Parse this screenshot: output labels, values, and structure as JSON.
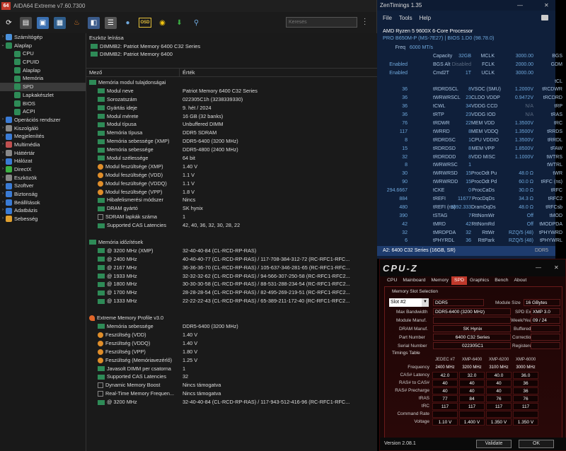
{
  "aida": {
    "title": "AIDA64 Extreme v7.60.7300",
    "logo": "64",
    "search_placeholder": "Keresés",
    "osd": "OSD",
    "tree": [
      {
        "label": "Számítógép",
        "depth": 0,
        "arrow": "›",
        "color": "#4a90d9"
      },
      {
        "label": "Alaplap",
        "depth": 0,
        "arrow": "⌄",
        "color": "#2e8b57"
      },
      {
        "label": "CPU",
        "depth": 1,
        "arrow": "",
        "color": "#2e8b57"
      },
      {
        "label": "CPUID",
        "depth": 1,
        "arrow": "",
        "color": "#2e8b57"
      },
      {
        "label": "Alaplap",
        "depth": 1,
        "arrow": "",
        "color": "#2e8b57"
      },
      {
        "label": "Memória",
        "depth": 1,
        "arrow": "",
        "color": "#2e8b57"
      },
      {
        "label": "SPD",
        "depth": 1,
        "arrow": "",
        "color": "#2e8b57",
        "selected": true
      },
      {
        "label": "Lapkakészlet",
        "depth": 1,
        "arrow": "",
        "color": "#2e8b57"
      },
      {
        "label": "BIOS",
        "depth": 1,
        "arrow": "",
        "color": "#2e8b57"
      },
      {
        "label": "ACPI",
        "depth": 1,
        "arrow": "",
        "color": "#2e8b57"
      },
      {
        "label": "Operációs rendszer",
        "depth": 0,
        "arrow": "›",
        "color": "#3a7bd5"
      },
      {
        "label": "Kiszolgáló",
        "depth": 0,
        "arrow": "›",
        "color": "#888888"
      },
      {
        "label": "Megjelenítés",
        "depth": 0,
        "arrow": "›",
        "color": "#3a7bd5"
      },
      {
        "label": "Multimédia",
        "depth": 0,
        "arrow": "›",
        "color": "#c05050"
      },
      {
        "label": "Háttértár",
        "depth": 0,
        "arrow": "›",
        "color": "#888888"
      },
      {
        "label": "Hálózat",
        "depth": 0,
        "arrow": "›",
        "color": "#3a7bd5"
      },
      {
        "label": "DirectX",
        "depth": 0,
        "arrow": "›",
        "color": "#3cb043"
      },
      {
        "label": "Eszközök",
        "depth": 0,
        "arrow": "›",
        "color": "#888888"
      },
      {
        "label": "Szoftver",
        "depth": 0,
        "arrow": "›",
        "color": "#3a7bd5"
      },
      {
        "label": "Biztonság",
        "depth": 0,
        "arrow": "›",
        "color": "#3a7bd5"
      },
      {
        "label": "Beállítások",
        "depth": 0,
        "arrow": "›",
        "color": "#3a7bd5"
      },
      {
        "label": "Adatbázis",
        "depth": 0,
        "arrow": "›",
        "color": "#3a7bd5"
      },
      {
        "label": "Sebesség",
        "depth": 0,
        "arrow": "›",
        "color": "#e0a030"
      }
    ],
    "device_header": "Eszköz leírása",
    "devices": [
      "DIMMB2: Patriot Memory 6400 C32 Series",
      "DIMMB2: Patriot Memory 6400"
    ],
    "col_field": "Mező",
    "col_value": "Érték",
    "rows": [
      {
        "type": "grp",
        "icon": "chip",
        "f": "Memória modul tulajdonságai",
        "v": ""
      },
      {
        "type": "sub",
        "icon": "chip",
        "f": "Modul neve",
        "v": "Patriot Memory 6400 C32 Series"
      },
      {
        "type": "sub",
        "icon": "chip",
        "f": "Sorozatszám",
        "v": "022305C1h (3238339330)"
      },
      {
        "type": "sub",
        "icon": "chip",
        "f": "Gyártás ideje",
        "v": "9. hét / 2024"
      },
      {
        "type": "sub",
        "icon": "chip",
        "f": "Modul mérete",
        "v": "16 GB (32 banks)"
      },
      {
        "type": "sub",
        "icon": "chip",
        "f": "Modul típusa",
        "v": "Unbuffered DIMM"
      },
      {
        "type": "sub",
        "icon": "chip",
        "f": "Memória típusa",
        "v": "DDR5 SDRAM"
      },
      {
        "type": "sub",
        "icon": "chip",
        "f": "Memória sebessége (XMP)",
        "v": "DDR5-6400 (3200 MHz)"
      },
      {
        "type": "sub",
        "icon": "chip",
        "f": "Memória sebessége",
        "v": "DDR5-4800 (2400 MHz)"
      },
      {
        "type": "sub",
        "icon": "chip",
        "f": "Modul szélessége",
        "v": "64 bit"
      },
      {
        "type": "sub",
        "icon": "warn",
        "f": "Modul feszültsége (XMP)",
        "v": "1.40 V"
      },
      {
        "type": "sub",
        "icon": "warn",
        "f": "Modul feszültsége (VDD)",
        "v": "1.1 V"
      },
      {
        "type": "sub",
        "icon": "warn",
        "f": "Modul feszültsége (VDDQ)",
        "v": "1.1 V"
      },
      {
        "type": "sub",
        "icon": "warn",
        "f": "Modul feszültsége (VPP)",
        "v": "1.8 V"
      },
      {
        "type": "sub",
        "icon": "chip",
        "f": "Hibafelismerési módszer",
        "v": "Nincs"
      },
      {
        "type": "sub",
        "icon": "chip",
        "f": "DRAM gyártó",
        "v": "SK hynix"
      },
      {
        "type": "sub",
        "icon": "chk",
        "f": "SDRAM lapkák száma",
        "v": "1"
      },
      {
        "type": "sub",
        "icon": "chip",
        "f": "Supported CAS Latencies",
        "v": "42, 40, 36, 32, 30, 28, 22"
      },
      {
        "type": "gap"
      },
      {
        "type": "grp",
        "icon": "chip",
        "f": "Memória időzítések",
        "v": ""
      },
      {
        "type": "sub",
        "icon": "chip",
        "f": "@ 3200 MHz (XMP)",
        "v": "32-40-40-84  (CL-RCD-RP-RAS)"
      },
      {
        "type": "sub",
        "icon": "chip",
        "f": "@ 2400 MHz",
        "v": "40-40-40-77  (CL-RCD-RP-RAS) / 117-708-384-312-72  (RC-RFC1-RFC..."
      },
      {
        "type": "sub",
        "icon": "chip",
        "f": "@ 2167 MHz",
        "v": "36-36-36-70  (CL-RCD-RP-RAS) / 105-637-346-281-65  (RC-RFC1-RFC..."
      },
      {
        "type": "sub",
        "icon": "chip",
        "f": "@ 1933 MHz",
        "v": "32-32-32-62  (CL-RCD-RP-RAS) / 94-566-307-250-58  (RC-RFC1-RFC2..."
      },
      {
        "type": "sub",
        "icon": "chip",
        "f": "@ 1800 MHz",
        "v": "30-30-30-58  (CL-RCD-RP-RAS) / 88-531-288-234-54  (RC-RFC1-RFC2..."
      },
      {
        "type": "sub",
        "icon": "chip",
        "f": "@ 1700 MHz",
        "v": "28-28-28-54  (CL-RCD-RP-RAS) / 82-495-269-219-51  (RC-RFC1-RFC2..."
      },
      {
        "type": "sub",
        "icon": "chip",
        "f": "@ 1333 MHz",
        "v": "22-22-22-43  (CL-RCD-RP-RAS) / 65-389-211-172-40  (RC-RFC1-RFC2..."
      },
      {
        "type": "gap"
      },
      {
        "type": "grp",
        "icon": "fire",
        "f": "Extreme Memory Profile v3.0",
        "v": ""
      },
      {
        "type": "sub",
        "icon": "chip",
        "f": "Memória sebessége",
        "v": "DDR5-6400 (3200 MHz)"
      },
      {
        "type": "sub",
        "icon": "warn",
        "f": "Feszültség (VDD)",
        "v": "1.40 V"
      },
      {
        "type": "sub",
        "icon": "warn",
        "f": "Feszültség (VDDQ)",
        "v": "1.40 V"
      },
      {
        "type": "sub",
        "icon": "warn",
        "f": "Feszültség (VPP)",
        "v": "1.80 V"
      },
      {
        "type": "sub",
        "icon": "warn",
        "f": "Feszültség (Memóriavezérlő)",
        "v": "1.25 V"
      },
      {
        "type": "sub",
        "icon": "chip",
        "f": "Javasolt DIMM per csatorna",
        "v": "1"
      },
      {
        "type": "sub",
        "icon": "chip",
        "f": "Supported CAS Latencies",
        "v": "32"
      },
      {
        "type": "sub",
        "icon": "chk",
        "f": "Dynamic Memory Boost",
        "v": "Nincs támogatva"
      },
      {
        "type": "sub",
        "icon": "chk",
        "f": "Real-Time Memory Frequen...",
        "v": "Nincs támogatva"
      },
      {
        "type": "sub",
        "icon": "chip",
        "f": "@ 3200 MHz",
        "v": "32-40-40-84  (CL-RCD-RP-RAS) / 117-943-512-416-96  (RC-RFC1-RFC..."
      }
    ]
  },
  "zen": {
    "title": "ZenTimings 1.35",
    "menu": [
      "File",
      "Tools",
      "Help"
    ],
    "cpu": "AMD Ryzen 5 9600X 6-Core Processor",
    "board": "PRO B650M-P (MS-7E27) | BIOS 1.D0 (98.78.0)",
    "grid": [
      [
        "Freq",
        "6000 MT/s",
        "",
        "Capacity",
        "32GB",
        "MCLK",
        "3000.00"
      ],
      [
        "BGS",
        "Enabled",
        "",
        "BGS Alt",
        "Disabled",
        "FCLK",
        "2000.00"
      ],
      [
        "GDM",
        "Enabled",
        "",
        "Cmd2T",
        "1T",
        "UCLK",
        "3000.00"
      ],
      [
        "",
        "",
        "",
        "",
        "",
        "",
        ""
      ],
      [
        "tCL",
        "36",
        "",
        "tRDRDSCL",
        "8",
        "VSOC (SMU)",
        "1.2000V"
      ],
      [
        "tRCDWR",
        "36",
        "",
        "tWRWRSCL",
        "23",
        "CLDO VDDP",
        "0.9472V"
      ],
      [
        "tRCDRD",
        "36",
        "",
        "tCWL",
        "34",
        "VDDG CCD",
        "N/A"
      ],
      [
        "tRP",
        "36",
        "",
        "tRTP",
        "23",
        "VDDG IOD",
        "N/A"
      ],
      [
        "tRAS",
        "76",
        "",
        "tRDWR",
        "22",
        "MEM VDD",
        "1.3500V"
      ],
      [
        "tRC",
        "117",
        "",
        "tWRRD",
        "8",
        "MEM VDDQ",
        "1.3500V"
      ],
      [
        "tRRDS",
        "8",
        "",
        "tRDRDSC",
        "1",
        "CPU VDDIO",
        "1.3500V"
      ],
      [
        "tRRDL",
        "15",
        "",
        "tRDRDSD",
        "8",
        "MEM VPP",
        "1.8500V"
      ],
      [
        "tFAW",
        "32",
        "",
        "tRDRDDD",
        "8",
        "VDD MISC",
        "1.1000V"
      ],
      [
        "tWTRS",
        "8",
        "",
        "tWRWRSC",
        "1",
        "",
        ""
      ],
      [
        "tWTRL",
        "30",
        "",
        "tWRWRSD",
        "15",
        "ProcOdt Pu",
        "48.0 Ω"
      ],
      [
        "tWR",
        "90",
        "",
        "tWRWRDD",
        "15",
        "ProcOdt Pd",
        "60.0 Ω"
      ],
      [
        "tRFC (ns)",
        "294.6667",
        "",
        "tCKE",
        "0",
        "ProcCaDs",
        "30.0 Ω"
      ],
      [
        "tRFC",
        "884",
        "",
        "tREFI",
        "11677",
        "ProcDqDs",
        "34.3 Ω"
      ],
      [
        "tRFC2",
        "480",
        "",
        "tREFI (ns)",
        "3892.333",
        "DramDqDs",
        "48.0 Ω"
      ],
      [
        "tRFCsb",
        "390",
        "",
        "tSTAG",
        "7",
        "RttNomWr",
        "Off"
      ],
      [
        "tMOD",
        "42",
        "",
        "tMRD",
        "42",
        "RttNomRd",
        "Off"
      ],
      [
        "tMODPDA",
        "32",
        "",
        "tMRDPDA",
        "32",
        "RttWr",
        "RZQ/5 (48)"
      ],
      [
        "tPHYWRD",
        "6",
        "",
        "tPHYRDL",
        "36",
        "RttPark",
        "RZQ/5 (48)"
      ],
      [
        "tPHYWRL",
        "22",
        "",
        "PowerDown",
        "Disabled",
        "RttParkDqs",
        "RZQ/6 (40)"
      ]
    ],
    "dimm": "A2: 6400 C32 Series (16GB, SR)",
    "dimm_type": "DDR5"
  },
  "cpuz": {
    "logo": "CPU-Z",
    "tabs": [
      "CPU",
      "Mainboard",
      "Memory",
      "SPD",
      "Graphics",
      "Bench",
      "About"
    ],
    "active_tab": "SPD",
    "group": "Memory Slot Selection",
    "slot": "Slot #2",
    "type": "DDR5",
    "module_size_label": "Module Size",
    "module_size": "16 GBytes",
    "max_bw_label": "Max Bandwidth",
    "max_bw": "DDR5-6400 (3200 MHz)",
    "spd_ext_label": "SPD Ext.",
    "spd_ext": "XMP 3.0",
    "mod_manuf_label": "Module Manuf.",
    "week_year_label": "Week/Year",
    "week_year": "09 / 24",
    "dram_manuf_label": "DRAM Manuf.",
    "dram_manuf": "SK Hynix",
    "buffered_label": "Buffered",
    "part_label": "Part Number",
    "part": "6400 C32 Series",
    "correction_label": "Correction",
    "serial_label": "Serial Number",
    "serial": "022305C1",
    "registered_label": "Registered",
    "timings_label": "Timings Table",
    "cols": [
      "JEDEC #7",
      "XMP-6400",
      "XMP-6200",
      "XMP-6000"
    ],
    "timing_rows": [
      {
        "label": "Frequency",
        "v": [
          "2400 MHz",
          "3200 MHz",
          "3100 MHz",
          "3000 MHz"
        ]
      },
      {
        "label": "CAS# Latency",
        "v": [
          "42.0",
          "32.0",
          "40.0",
          "36.0"
        ]
      },
      {
        "label": "RAS# to CAS#",
        "v": [
          "40",
          "40",
          "40",
          "36"
        ]
      },
      {
        "label": "RAS# Precharge",
        "v": [
          "40",
          "40",
          "40",
          "36"
        ]
      },
      {
        "label": "tRAS",
        "v": [
          "77",
          "84",
          "76",
          "76"
        ]
      },
      {
        "label": "tRC",
        "v": [
          "117",
          "117",
          "117",
          "117"
        ]
      },
      {
        "label": "Command Rate",
        "v": [
          "",
          "",
          "",
          ""
        ]
      },
      {
        "label": "Voltage",
        "v": [
          "1.10 V",
          "1.400 V",
          "1.350 V",
          "1.350 V"
        ]
      }
    ],
    "version": "Version 2.08.1",
    "validate": "Validate",
    "ok": "OK"
  }
}
